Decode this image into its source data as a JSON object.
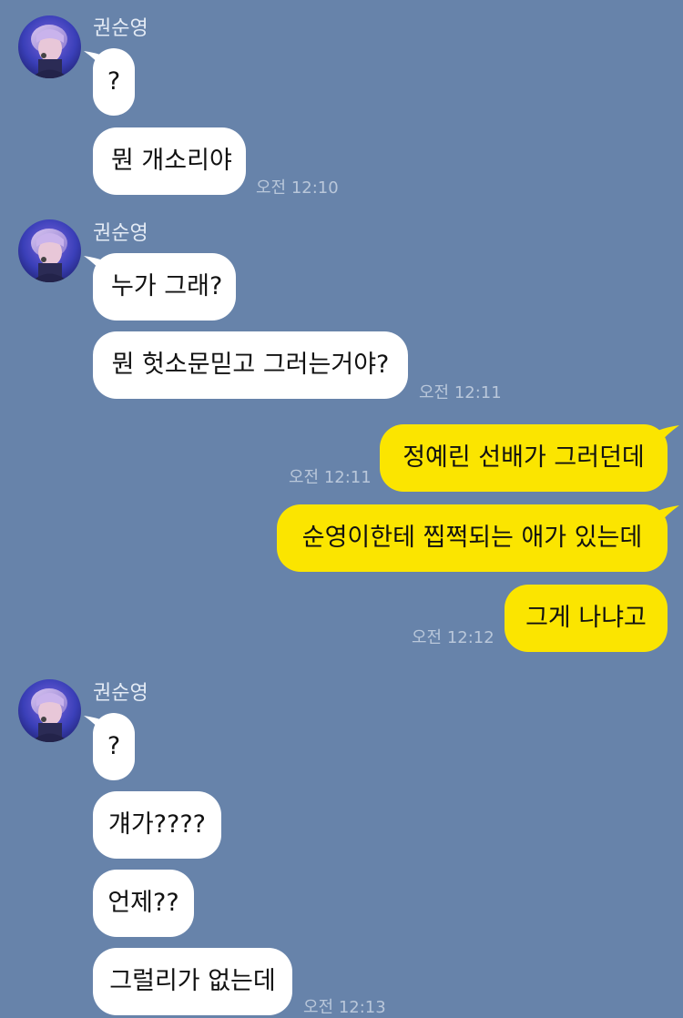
{
  "chat": {
    "groups": [
      {
        "sender": "권순영",
        "messages": [
          "?",
          "뭔 개소리야"
        ],
        "time": "오전 12:10"
      },
      {
        "sender": "권순영",
        "messages": [
          "누가 그래?",
          "뭔 헛소문믿고 그러는거야?"
        ],
        "time": "오전 12:11"
      },
      {
        "sender": "me",
        "messages": [
          "정예린 선배가 그러던데",
          "순영이한테 찝쩍되는 애가 있는데",
          "그게 나냐고"
        ],
        "times": [
          "오전 12:11",
          "오전 12:12"
        ]
      },
      {
        "sender": "권순영",
        "messages": [
          "?",
          "걔가????",
          "언제??",
          "그럴리가 없는데"
        ],
        "time": "오전 12:13"
      }
    ]
  },
  "colors": {
    "background": "#6783aa",
    "incoming_bubble": "#ffffff",
    "outgoing_bubble": "#fbe500",
    "timestamp": "#b9c7da"
  }
}
